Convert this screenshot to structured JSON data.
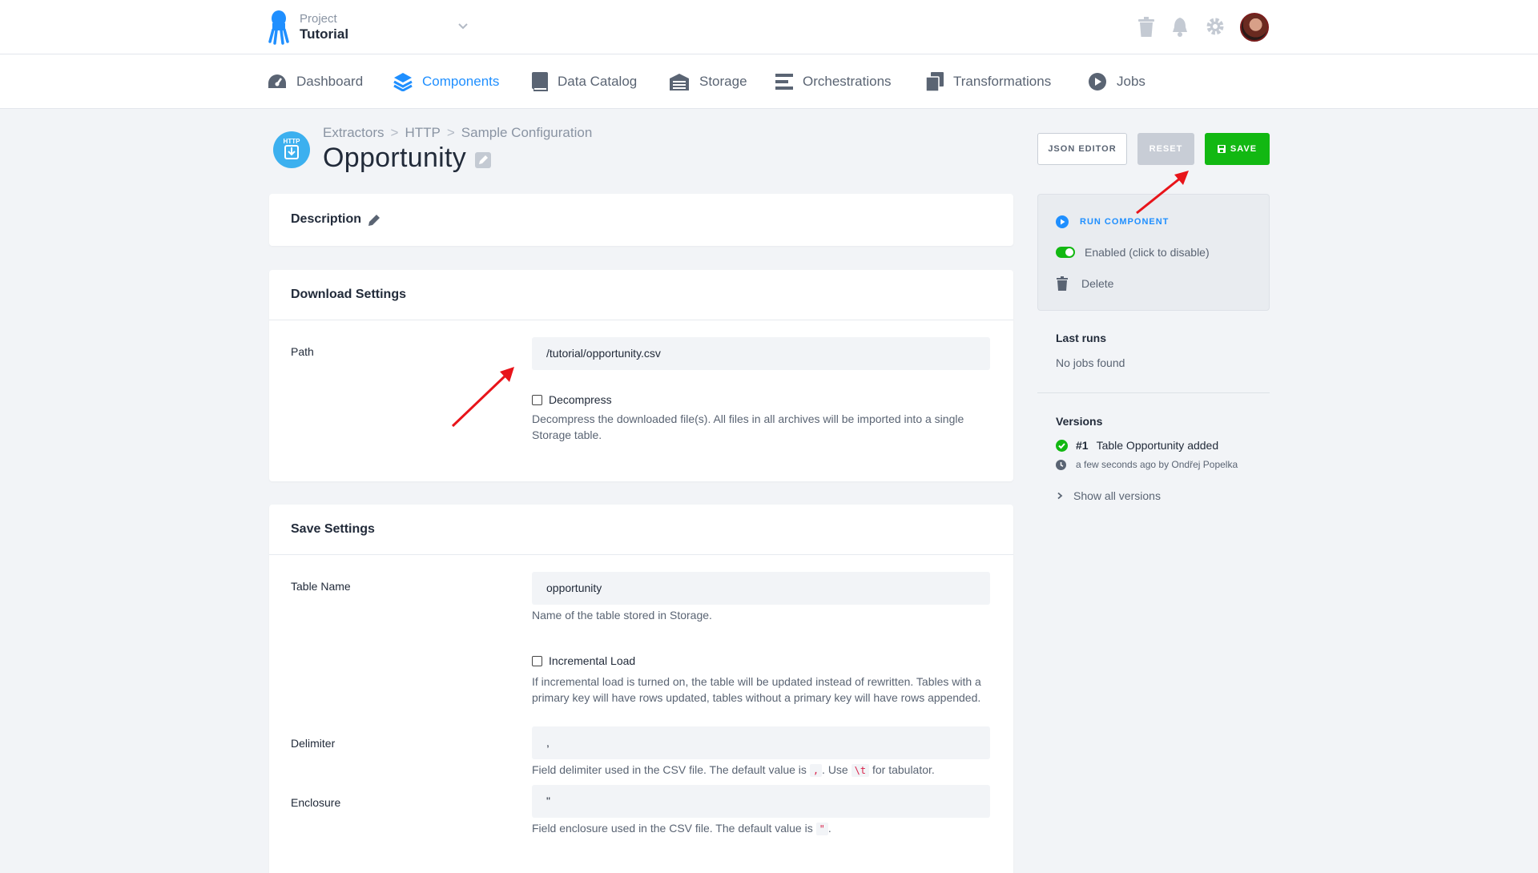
{
  "topbar": {
    "project_label": "Project",
    "project_name": "Tutorial",
    "icons": [
      "trash-icon",
      "bell-icon",
      "gear-icon",
      "avatar"
    ]
  },
  "nav": {
    "items": [
      {
        "label": "Dashboard",
        "icon": "dashboard-icon",
        "active": false
      },
      {
        "label": "Components",
        "icon": "layers-icon",
        "active": true
      },
      {
        "label": "Data Catalog",
        "icon": "book-icon",
        "active": false
      },
      {
        "label": "Storage",
        "icon": "storage-icon",
        "active": false
      },
      {
        "label": "Orchestrations",
        "icon": "bars-icon",
        "active": false
      },
      {
        "label": "Transformations",
        "icon": "copy-icon",
        "active": false
      },
      {
        "label": "Jobs",
        "icon": "play-icon",
        "active": false
      }
    ]
  },
  "header": {
    "component_icon_text": "HTTP",
    "breadcrumb": [
      "Extractors",
      "HTTP",
      "Sample Configuration"
    ],
    "breadcrumb_separator": ">",
    "title": "Opportunity"
  },
  "actions": {
    "json_editor": "JSON EDITOR",
    "reset": "RESET",
    "save": "SAVE"
  },
  "description_card": {
    "title": "Description"
  },
  "download_settings": {
    "title": "Download Settings",
    "path_label": "Path",
    "path_value": "/tutorial/opportunity.csv",
    "decompress_label": "Decompress",
    "decompress_checked": false,
    "decompress_help": "Decompress the downloaded file(s). All files in all archives will be imported into a single Storage table."
  },
  "save_settings": {
    "title": "Save Settings",
    "table_name_label": "Table Name",
    "table_name_value": "opportunity",
    "table_name_help": "Name of the table stored in Storage.",
    "incremental_label": "Incremental Load",
    "incremental_checked": false,
    "incremental_help": "If incremental load is turned on, the table will be updated instead of rewritten. Tables with a primary key will have rows updated, tables without a primary key will have rows appended.",
    "delimiter_label": "Delimiter",
    "delimiter_value": ",",
    "delimiter_help_1": "Field delimiter used in the CSV file. The default value is",
    "delimiter_code_1": ",",
    "delimiter_help_2": ". Use",
    "delimiter_code_2": "\\t",
    "delimiter_help_3": "for tabulator.",
    "enclosure_label": "Enclosure",
    "enclosure_value": "\"",
    "enclosure_help_1": "Field enclosure used in the CSV file. The default value is",
    "enclosure_code": "\"",
    "enclosure_help_2": "."
  },
  "sidebar": {
    "run_component": "RUN COMPONENT",
    "enabled_text": "Enabled (click to disable)",
    "enabled": true,
    "delete": "Delete",
    "last_runs_title": "Last runs",
    "last_runs_empty": "No jobs found",
    "versions_title": "Versions",
    "version_number": "#1",
    "version_description": "Table Opportunity added",
    "version_meta": "a few seconds ago by Ondřej Popelka",
    "show_all_versions": "Show all versions"
  },
  "colors": {
    "accent": "#1f8fff",
    "save_green": "#12b812",
    "arrow_red": "#e8141a"
  }
}
